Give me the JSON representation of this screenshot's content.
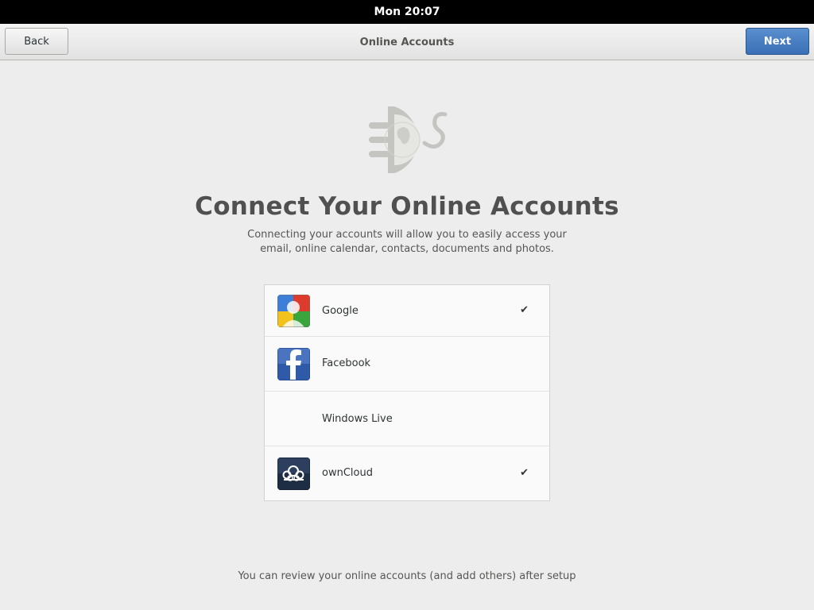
{
  "topbar": {
    "clock": "Mon 20:07"
  },
  "header": {
    "back_label": "Back",
    "title": "Online Accounts",
    "next_label": "Next"
  },
  "logo": {
    "icon": "online-accounts-plug-globe-icon"
  },
  "main": {
    "title": "Connect Your Online Accounts",
    "subtitle_line1": "Connecting your accounts will allow you to easily access your",
    "subtitle_line2": "email, online calendar, contacts, documents and photos."
  },
  "accounts": [
    {
      "label": "Google",
      "icon": "google-icon",
      "checked": true,
      "check_glyph": "✔"
    },
    {
      "label": "Facebook",
      "icon": "facebook-icon",
      "checked": false,
      "check_glyph": ""
    },
    {
      "label": "Windows Live",
      "icon": "",
      "checked": false,
      "check_glyph": ""
    },
    {
      "label": "ownCloud",
      "icon": "owncloud-icon",
      "checked": true,
      "check_glyph": "✔"
    }
  ],
  "footer": {
    "note": "You can review your online accounts (and add others) after setup"
  },
  "colors": {
    "accent": "#3a6fb5",
    "background": "#ededed",
    "topbar": "#000000"
  }
}
